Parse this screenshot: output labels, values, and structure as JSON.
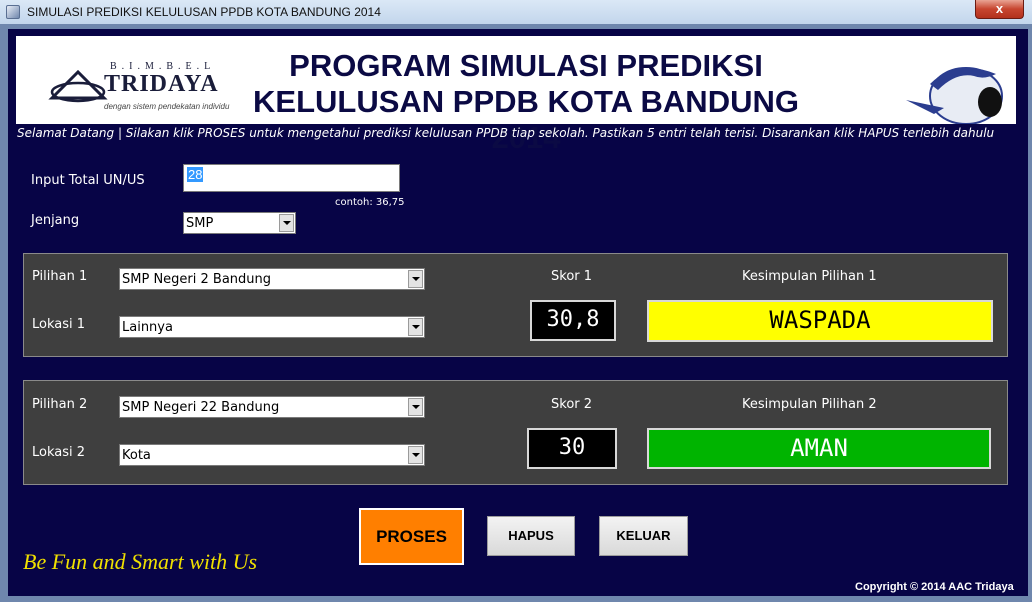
{
  "window": {
    "title": "SIMULASI PREDIKSI KELULUSAN PPDB KOTA BANDUNG 2014",
    "close_label": "x"
  },
  "banner": {
    "logo_top": "B.I.M.B.E.L",
    "logo_name": "TRIDAYA",
    "logo_tagline": "dengan sistem pendekatan individu",
    "title_line1": "PROGRAM SIMULASI PREDIKSI",
    "title_line2": "KELULUSAN PPDB KOTA BANDUNG 2014"
  },
  "marquee": "Selamat Datang | Silakan klik PROSES untuk mengetahui prediksi kelulusan PPDB tiap sekolah. Pastikan 5 entri telah terisi. Disarankan klik HAPUS terlebih dahulu",
  "form": {
    "total_label": "Input Total UN/US",
    "total_value": "28",
    "total_hint": "contoh: 36,75",
    "jenjang_label": "Jenjang",
    "jenjang_value": "SMP"
  },
  "pilihan1": {
    "pilihan_label": "Pilihan 1",
    "pilihan_value": "SMP Negeri 2 Bandung",
    "lokasi_label": "Lokasi 1",
    "lokasi_value": "Lainnya",
    "skor_label": "Skor 1",
    "skor_value": "30,8",
    "kesimpulan_label": "Kesimpulan Pilihan 1",
    "kesimpulan_value": "WASPADA",
    "kesimpulan_color": "#ffff00",
    "kesimpulan_text_color": "#000000"
  },
  "pilihan2": {
    "pilihan_label": "Pilihan 2",
    "pilihan_value": "SMP Negeri 22 Bandung",
    "lokasi_label": "Lokasi  2",
    "lokasi_value": "Kota",
    "skor_label": "Skor 2",
    "skor_value": "30",
    "kesimpulan_label": "Kesimpulan Pilihan 2",
    "kesimpulan_value": "AMAN",
    "kesimpulan_color": "#00b400",
    "kesimpulan_text_color": "#ffffff"
  },
  "buttons": {
    "proses": "PROSES",
    "hapus": "HAPUS",
    "keluar": "KELUAR"
  },
  "footer": {
    "slogan": "Be Fun and Smart with Us",
    "copyright": "Copyright © 2014 AAC Tridaya"
  },
  "colors": {
    "background": "#070446",
    "accent": "#ff7f00",
    "slogan": "#f0e000"
  }
}
